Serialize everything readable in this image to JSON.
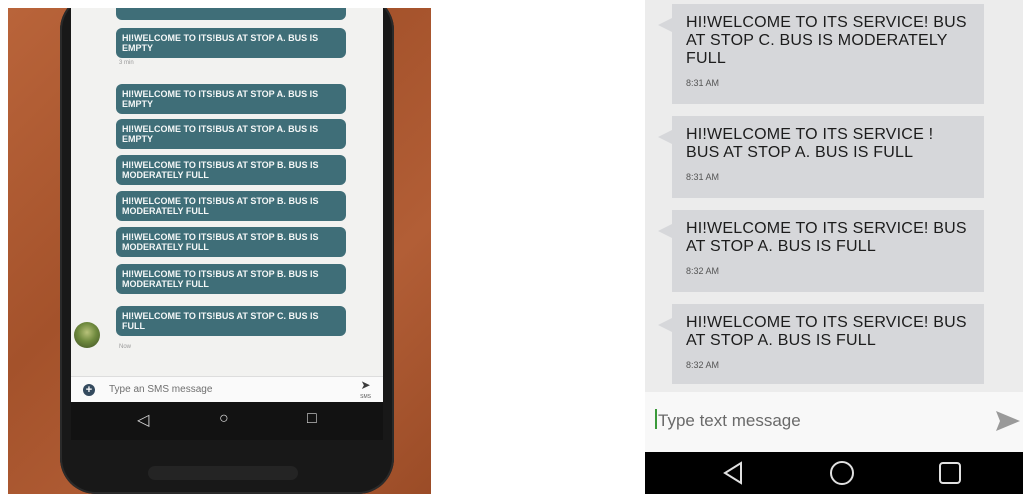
{
  "left_phone": {
    "messages": [
      {
        "text": "HI!WELCOME TO ITS!BUS AT STOP A. BUS IS EMPTY",
        "time": "3 min"
      },
      {
        "text": "HI!WELCOME TO ITS!BUS AT STOP A. BUS IS EMPTY",
        "time": ""
      },
      {
        "text": "HI!WELCOME TO ITS!BUS AT STOP A. BUS IS EMPTY",
        "time": ""
      },
      {
        "text": "HI!WELCOME TO ITS!BUS AT STOP B. BUS IS MODERATELY FULL",
        "time": ""
      },
      {
        "text": "HI!WELCOME TO ITS!BUS AT STOP B. BUS IS MODERATELY FULL",
        "time": ""
      },
      {
        "text": "HI!WELCOME TO ITS!BUS AT STOP B. BUS IS MODERATELY FULL",
        "time": ""
      },
      {
        "text": "HI!WELCOME TO ITS!BUS AT STOP B. BUS IS MODERATELY FULL",
        "time": ""
      },
      {
        "text": "HI!WELCOME TO ITS!BUS AT STOP C. BUS IS FULL",
        "time": "Now"
      }
    ],
    "compose_placeholder": "Type an SMS message",
    "send_label": "SMS",
    "bubble_color": "#3f6e78"
  },
  "right_phone": {
    "messages": [
      {
        "text": "HI!WELCOME TO ITS SERVICE! BUS AT STOP C. BUS IS MODERATELY FULL",
        "time": "8:31 AM"
      },
      {
        "text": "HI!WELCOME TO ITS SERVICE ! BUS AT STOP A. BUS IS FULL",
        "time": "8:31 AM"
      },
      {
        "text": "HI!WELCOME TO ITS SERVICE! BUS AT STOP A. BUS IS FULL",
        "time": "8:32 AM"
      },
      {
        "text": "HI!WELCOME TO ITS SERVICE! BUS AT STOP A. BUS IS FULL",
        "time": "8:32 AM"
      }
    ],
    "compose_placeholder": "Type text message",
    "bubble_color": "#d6d7da"
  },
  "nav_icons": [
    "back-icon",
    "home-icon",
    "recents-icon"
  ]
}
